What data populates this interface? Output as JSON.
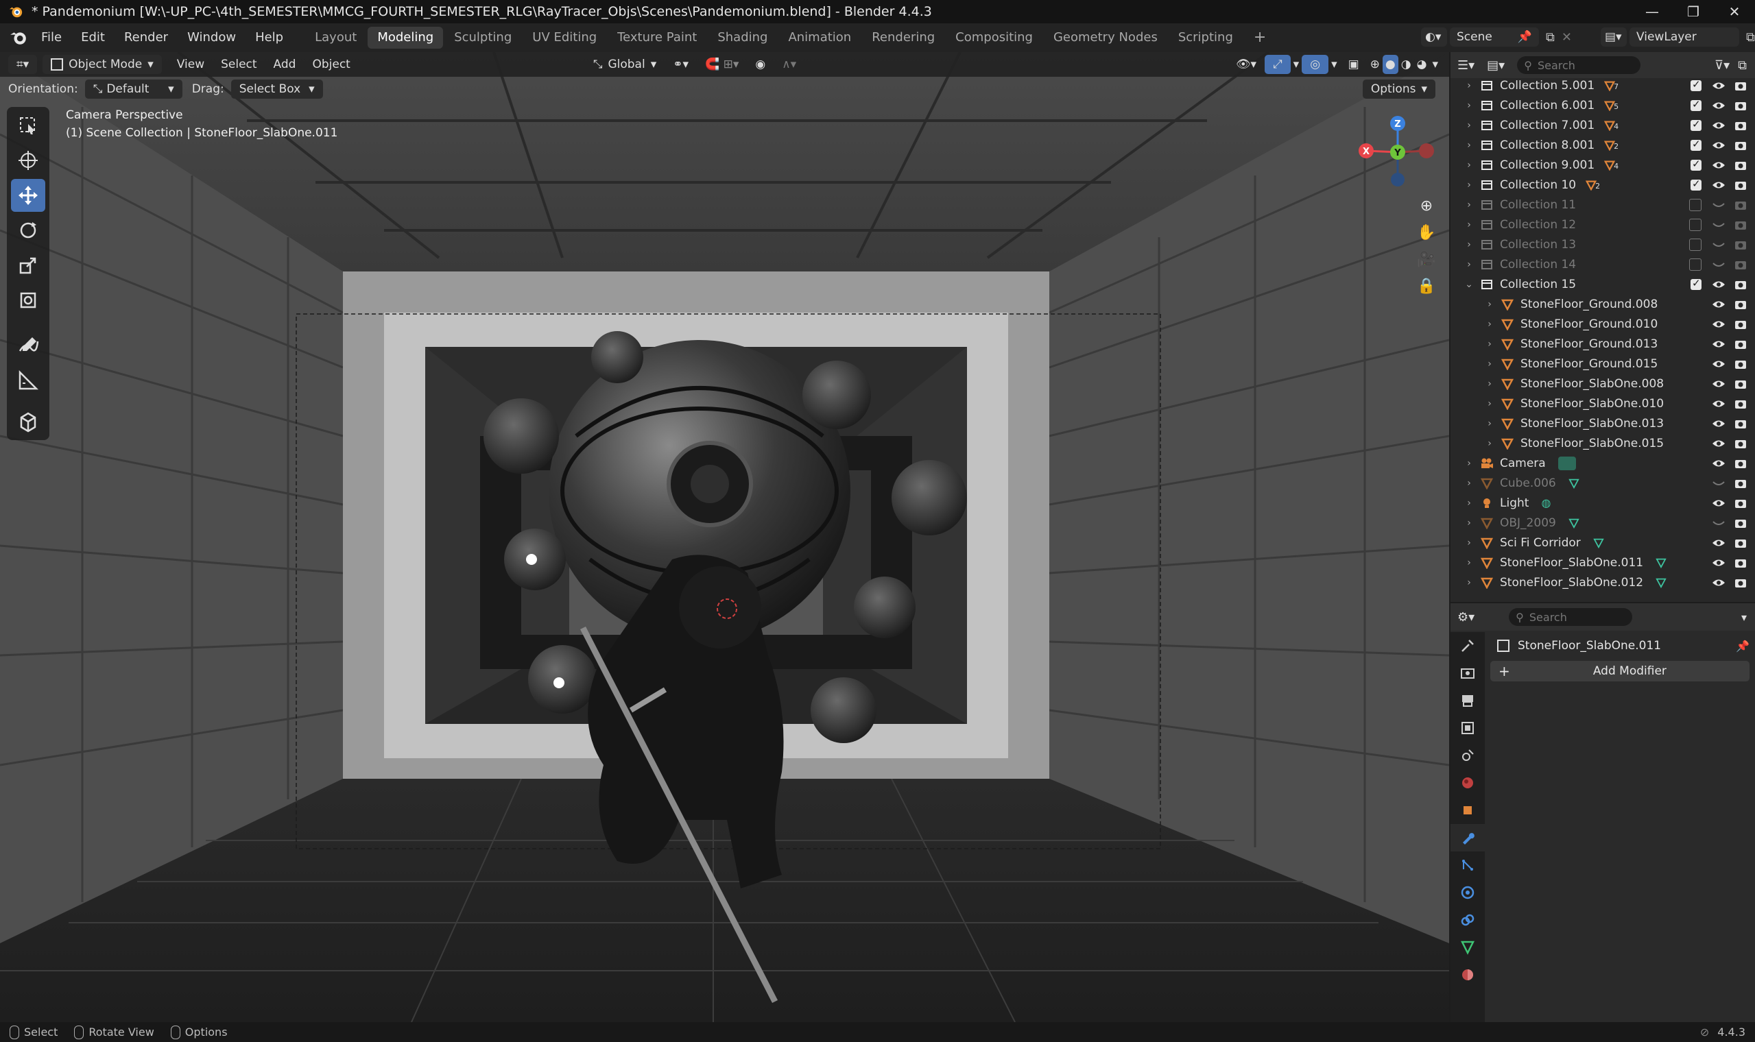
{
  "titlebar": {
    "title": "* Pandemonium [W:\\-UP_PC-\\4th_SEMESTER\\MMCG_FOURTH_SEMESTER_RLG\\RayTracer_Objs\\Scenes\\Pandemonium.blend] - Blender 4.4.3"
  },
  "menu": {
    "items": [
      "File",
      "Edit",
      "Render",
      "Window",
      "Help"
    ]
  },
  "workspaces": [
    "Layout",
    "Modeling",
    "Sculpting",
    "UV Editing",
    "Texture Paint",
    "Shading",
    "Animation",
    "Rendering",
    "Compositing",
    "Geometry Nodes",
    "Scripting"
  ],
  "active_workspace": "Modeling",
  "scene": {
    "name": "Scene",
    "view_layer": "ViewLayer"
  },
  "viewport": {
    "mode": "Object Mode",
    "menus": [
      "View",
      "Select",
      "Add",
      "Object"
    ],
    "transform": "Global",
    "orientation_label": "Orientation:",
    "orientation_value": "Default",
    "drag_label": "Drag:",
    "drag_value": "Select Box",
    "options": "Options",
    "overlay_line1": "Camera Perspective",
    "overlay_line2": "(1) Scene Collection | StoneFloor_SlabOne.011",
    "gizmo": {
      "z": "Z",
      "y": "Y",
      "x": "X"
    }
  },
  "outliner": {
    "search_placeholder": "Search",
    "rows": [
      {
        "label": "Collection 5.001",
        "kind": "collection",
        "badge": "7",
        "checked": true,
        "dim": false,
        "indent": 0
      },
      {
        "label": "Collection 6.001",
        "kind": "collection",
        "badge": "5",
        "checked": true,
        "dim": false,
        "indent": 0
      },
      {
        "label": "Collection 7.001",
        "kind": "collection",
        "badge": "4",
        "checked": true,
        "dim": false,
        "indent": 0
      },
      {
        "label": "Collection 8.001",
        "kind": "collection",
        "badge": "2",
        "checked": true,
        "dim": false,
        "indent": 0
      },
      {
        "label": "Collection 9.001",
        "kind": "collection",
        "badge": "4",
        "checked": true,
        "dim": false,
        "indent": 0
      },
      {
        "label": "Collection 10",
        "kind": "collection",
        "badge": "2",
        "checked": true,
        "dim": false,
        "indent": 0
      },
      {
        "label": "Collection 11",
        "kind": "collection",
        "badge": "",
        "checked": false,
        "dim": true,
        "indent": 0
      },
      {
        "label": "Collection 12",
        "kind": "collection",
        "badge": "",
        "checked": false,
        "dim": true,
        "indent": 0
      },
      {
        "label": "Collection 13",
        "kind": "collection",
        "badge": "",
        "checked": false,
        "dim": true,
        "indent": 0
      },
      {
        "label": "Collection 14",
        "kind": "collection",
        "badge": "",
        "checked": false,
        "dim": true,
        "indent": 0
      },
      {
        "label": "Collection 15",
        "kind": "collection",
        "badge": "",
        "checked": true,
        "dim": false,
        "indent": 0
      },
      {
        "label": "StoneFloor_Ground.008",
        "kind": "mesh",
        "badge": "",
        "checked": null,
        "dim": false,
        "indent": 1
      },
      {
        "label": "StoneFloor_Ground.010",
        "kind": "mesh",
        "badge": "",
        "checked": null,
        "dim": false,
        "indent": 1
      },
      {
        "label": "StoneFloor_Ground.013",
        "kind": "mesh",
        "badge": "",
        "checked": null,
        "dim": false,
        "indent": 1
      },
      {
        "label": "StoneFloor_Ground.015",
        "kind": "mesh",
        "badge": "",
        "checked": null,
        "dim": false,
        "indent": 1
      },
      {
        "label": "StoneFloor_SlabOne.008",
        "kind": "mesh",
        "badge": "",
        "checked": null,
        "dim": false,
        "indent": 1
      },
      {
        "label": "StoneFloor_SlabOne.010",
        "kind": "mesh",
        "badge": "",
        "checked": null,
        "dim": false,
        "indent": 1
      },
      {
        "label": "StoneFloor_SlabOne.013",
        "kind": "mesh",
        "badge": "",
        "checked": null,
        "dim": false,
        "indent": 1
      },
      {
        "label": "StoneFloor_SlabOne.015",
        "kind": "mesh",
        "badge": "",
        "checked": null,
        "dim": false,
        "indent": 1
      },
      {
        "label": "Camera",
        "kind": "camera",
        "badge": "",
        "checked": null,
        "dim": false,
        "indent": 0
      },
      {
        "label": "Cube.006",
        "kind": "mesh",
        "badge": "",
        "checked": null,
        "dim": true,
        "indent": 0
      },
      {
        "label": "Light",
        "kind": "light",
        "badge": "",
        "checked": null,
        "dim": false,
        "indent": 0
      },
      {
        "label": "OBJ_2009",
        "kind": "mesh",
        "badge": "",
        "checked": null,
        "dim": true,
        "indent": 0
      },
      {
        "label": "Sci Fi Corridor",
        "kind": "mesh",
        "badge": "",
        "checked": null,
        "dim": false,
        "indent": 0
      },
      {
        "label": "StoneFloor_SlabOne.011",
        "kind": "mesh",
        "badge": "",
        "checked": null,
        "dim": false,
        "indent": 0
      },
      {
        "label": "StoneFloor_SlabOne.012",
        "kind": "mesh",
        "badge": "",
        "checked": null,
        "dim": false,
        "indent": 0
      }
    ]
  },
  "properties": {
    "search_placeholder": "Search",
    "object_name": "StoneFloor_SlabOne.011",
    "add_modifier": "Add Modifier"
  },
  "statusbar": {
    "select": "Select",
    "rotate": "Rotate View",
    "options": "Options",
    "version": "4.4.3"
  },
  "colors": {
    "accent": "#4772b3",
    "mesh": "#e0853a",
    "x": "#e8454a",
    "y": "#6ec43a",
    "z": "#3b82e0"
  }
}
